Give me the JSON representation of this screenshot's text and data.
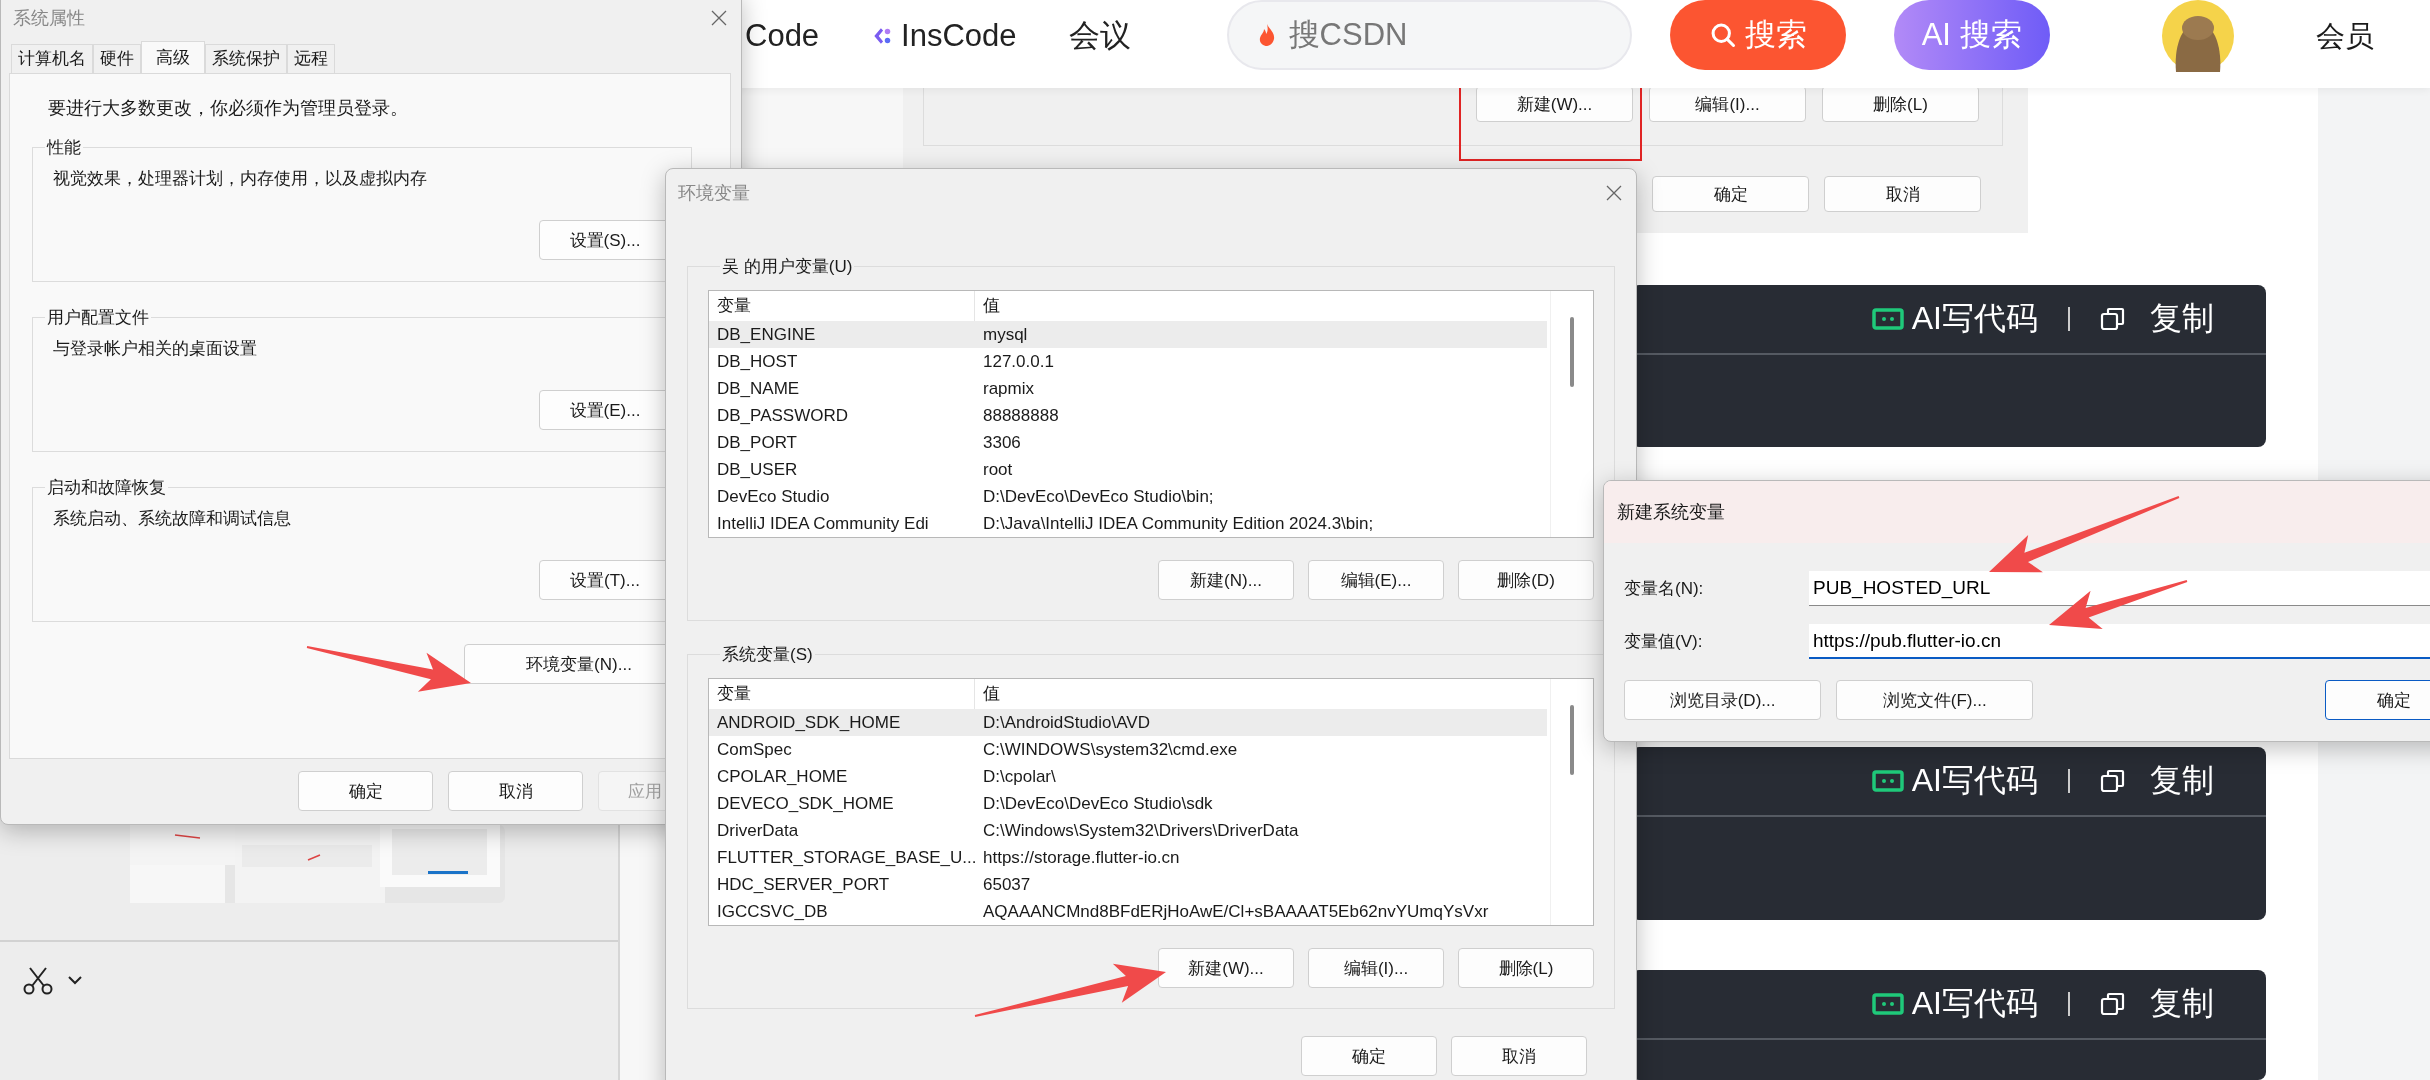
{
  "web_page": {
    "nav": [
      {
        "label": "Code",
        "kind": "text"
      },
      {
        "label": "InsCode",
        "kind": "logo"
      },
      {
        "label": "会议",
        "kind": "text"
      }
    ],
    "search": {
      "placeholder": "搜CSDN"
    },
    "search_button": "搜索",
    "ai_search_button": "AI 搜索",
    "member_link": "会员",
    "article_image": {
      "buttons": [
        {
          "label": "新建(W)...",
          "highlighted": true
        },
        {
          "label": "编辑(I)...",
          "highlighted": false
        },
        {
          "label": "删除(L)",
          "highlighted": false
        }
      ],
      "dialog_buttons": [
        "确定",
        "取消"
      ]
    },
    "code_blocks": [
      {
        "ai_label": "AI写代码",
        "copy_label": "复制"
      },
      {
        "ai_label": "AI写代码",
        "copy_label": "复制"
      },
      {
        "ai_label": "AI写代码",
        "copy_label": "复制"
      }
    ]
  },
  "system_properties": {
    "title": "系统属性",
    "tabs": [
      {
        "label": "计算机名",
        "selected": false
      },
      {
        "label": "硬件",
        "selected": false
      },
      {
        "label": "高级",
        "selected": true
      },
      {
        "label": "系统保护",
        "selected": false
      },
      {
        "label": "远程",
        "selected": false
      }
    ],
    "notice": "要进行大多数更改，你必须作为管理员登录。",
    "groups": [
      {
        "legend": "性能",
        "description": "视觉效果，处理器计划，内存使用，以及虚拟内存",
        "button": "设置(S)..."
      },
      {
        "legend": "用户配置文件",
        "description": "与登录帐户相关的桌面设置",
        "button": "设置(E)..."
      },
      {
        "legend": "启动和故障恢复",
        "description": "系统启动、系统故障和调试信息",
        "button": "设置(T)..."
      }
    ],
    "env_button": "环境变量(N)...",
    "buttons": [
      {
        "label": "确定",
        "disabled": false
      },
      {
        "label": "取消",
        "disabled": false
      },
      {
        "label": "应用",
        "disabled": true
      }
    ]
  },
  "environment_variables": {
    "title": "环境变量",
    "user_variables": {
      "legend": "吴 的用户变量(U)",
      "columns": [
        "变量",
        "值"
      ],
      "rows": [
        {
          "name": "DB_ENGINE",
          "value": "mysql",
          "selected": true
        },
        {
          "name": "DB_HOST",
          "value": "127.0.0.1",
          "selected": false
        },
        {
          "name": "DB_NAME",
          "value": "rapmix",
          "selected": false
        },
        {
          "name": "DB_PASSWORD",
          "value": "88888888",
          "selected": false
        },
        {
          "name": "DB_PORT",
          "value": "3306",
          "selected": false
        },
        {
          "name": "DB_USER",
          "value": "root",
          "selected": false
        },
        {
          "name": "DevEco Studio",
          "value": "D:\\DevEco\\DevEco Studio\\bin;",
          "selected": false
        },
        {
          "name": "IntelliJ IDEA Community Edi",
          "value": "D:\\Java\\IntelliJ IDEA Community Edition 2024.3\\bin;",
          "selected": false
        }
      ],
      "buttons": [
        "新建(N)...",
        "编辑(E)...",
        "删除(D)"
      ]
    },
    "system_variables": {
      "legend": "系统变量(S)",
      "columns": [
        "变量",
        "值"
      ],
      "rows": [
        {
          "name": "ANDROID_SDK_HOME",
          "value": "D:\\AndroidStudio\\AVD",
          "selected": true
        },
        {
          "name": "ComSpec",
          "value": "C:\\WINDOWS\\system32\\cmd.exe",
          "selected": false
        },
        {
          "name": "CPOLAR_HOME",
          "value": "D:\\cpolar\\",
          "selected": false
        },
        {
          "name": "DEVECO_SDK_HOME",
          "value": "D:\\DevEco\\DevEco Studio\\sdk",
          "selected": false
        },
        {
          "name": "DriverData",
          "value": "C:\\Windows\\System32\\Drivers\\DriverData",
          "selected": false
        },
        {
          "name": "FLUTTER_STORAGE_BASE_U...",
          "value": "https://storage.flutter-io.cn",
          "selected": false
        },
        {
          "name": "HDC_SERVER_PORT",
          "value": "65037",
          "selected": false
        },
        {
          "name": "IGCCSVC_DB",
          "value": "AQAAANCMnd8BFdERjHoAwE/Cl+sBAAAAT5Eb62nvYUmqYsVxr",
          "selected": false
        }
      ],
      "buttons": [
        "新建(W)...",
        "编辑(I)...",
        "删除(L)"
      ]
    },
    "buttons": [
      "确定",
      "取消"
    ]
  },
  "new_system_variable": {
    "title": "新建系统变量",
    "fields": [
      {
        "label": "变量名(N):",
        "value": "PUB_HOSTED_URL",
        "focused": false
      },
      {
        "label": "变量值(V):",
        "value": "https://pub.flutter-io.cn",
        "focused": true
      }
    ],
    "buttons": [
      {
        "label": "浏览目录(D)...",
        "default": false
      },
      {
        "label": "浏览文件(F)...",
        "default": false
      },
      {
        "label": "确定",
        "default": true
      }
    ]
  }
}
